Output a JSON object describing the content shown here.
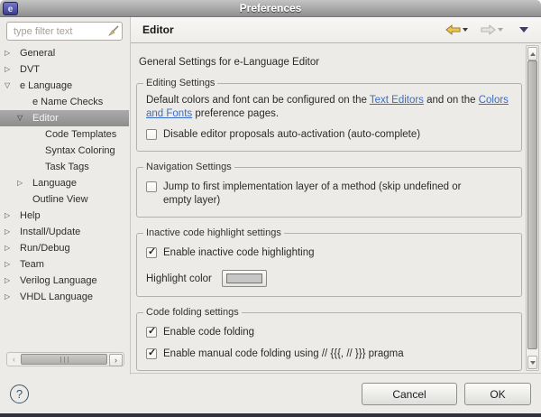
{
  "window": {
    "title": "Preferences"
  },
  "sidebar": {
    "filter_placeholder": "type filter text",
    "tree": [
      {
        "label": "General",
        "level": 0,
        "state": "collapsed",
        "selected": false
      },
      {
        "label": "DVT",
        "level": 0,
        "state": "collapsed",
        "selected": false
      },
      {
        "label": "e Language",
        "level": 0,
        "state": "expanded",
        "selected": false
      },
      {
        "label": "e Name Checks",
        "level": 1,
        "state": "leaf",
        "selected": false
      },
      {
        "label": "Editor",
        "level": 1,
        "state": "expanded",
        "selected": true
      },
      {
        "label": "Code Templates",
        "level": 2,
        "state": "leaf",
        "selected": false
      },
      {
        "label": "Syntax Coloring",
        "level": 2,
        "state": "leaf",
        "selected": false
      },
      {
        "label": "Task Tags",
        "level": 2,
        "state": "leaf",
        "selected": false
      },
      {
        "label": "Language",
        "level": 1,
        "state": "collapsed",
        "selected": false
      },
      {
        "label": "Outline View",
        "level": 1,
        "state": "leaf",
        "selected": false
      },
      {
        "label": "Help",
        "level": 0,
        "state": "collapsed",
        "selected": false
      },
      {
        "label": "Install/Update",
        "level": 0,
        "state": "collapsed",
        "selected": false
      },
      {
        "label": "Run/Debug",
        "level": 0,
        "state": "collapsed",
        "selected": false
      },
      {
        "label": "Team",
        "level": 0,
        "state": "collapsed",
        "selected": false
      },
      {
        "label": "Verilog Language",
        "level": 0,
        "state": "collapsed",
        "selected": false
      },
      {
        "label": "VHDL Language",
        "level": 0,
        "state": "collapsed",
        "selected": false
      }
    ]
  },
  "header": {
    "title": "Editor"
  },
  "content": {
    "intro": "General Settings for e-Language Editor",
    "groups": [
      {
        "title": "Editing Settings",
        "paragraph": {
          "before_link1": "Default colors and font can be configured on the ",
          "link1": "Text Editors",
          "between_links": " and on the ",
          "link2": "Colors and Fonts",
          "after_link2": " preference pages."
        },
        "checkbox": {
          "checked": false,
          "label": "Disable editor proposals auto-activation (auto-complete)"
        }
      },
      {
        "title": "Navigation Settings",
        "checkbox": {
          "checked": false,
          "label": "Jump to first implementation layer of a method (skip undefined or empty layer)"
        }
      },
      {
        "title": "Inactive code highlight settings",
        "checkbox": {
          "checked": true,
          "label": "Enable inactive code highlighting"
        },
        "highlight_color_label": "Highlight color",
        "swatch_color": "#c6c6c6"
      },
      {
        "title": "Code folding settings",
        "checkboxes": [
          {
            "checked": true,
            "label": "Enable code folding"
          },
          {
            "checked": true,
            "label": "Enable manual code folding using // {{{, // }}} pragma"
          }
        ]
      }
    ]
  },
  "footer": {
    "help_label": "?",
    "cancel_label": "Cancel",
    "ok_label": "OK"
  },
  "icons": {
    "app": "eclipse-logo",
    "filter_clear": "broom",
    "tree_collapsed": "▷",
    "tree_expanded": "▽",
    "back": "gold-left-arrow",
    "forward": "gray-right-arrow",
    "view_menu": "down-triangle",
    "help": "circled-question-mark"
  },
  "colors": {
    "link": "#3b6cc5",
    "selected_tree_item_bg": "#9b9b9b",
    "titlebar": "#a9a9a9",
    "highlight_swatch": "#c6c6c6",
    "back_arrow": "#eac64f"
  }
}
